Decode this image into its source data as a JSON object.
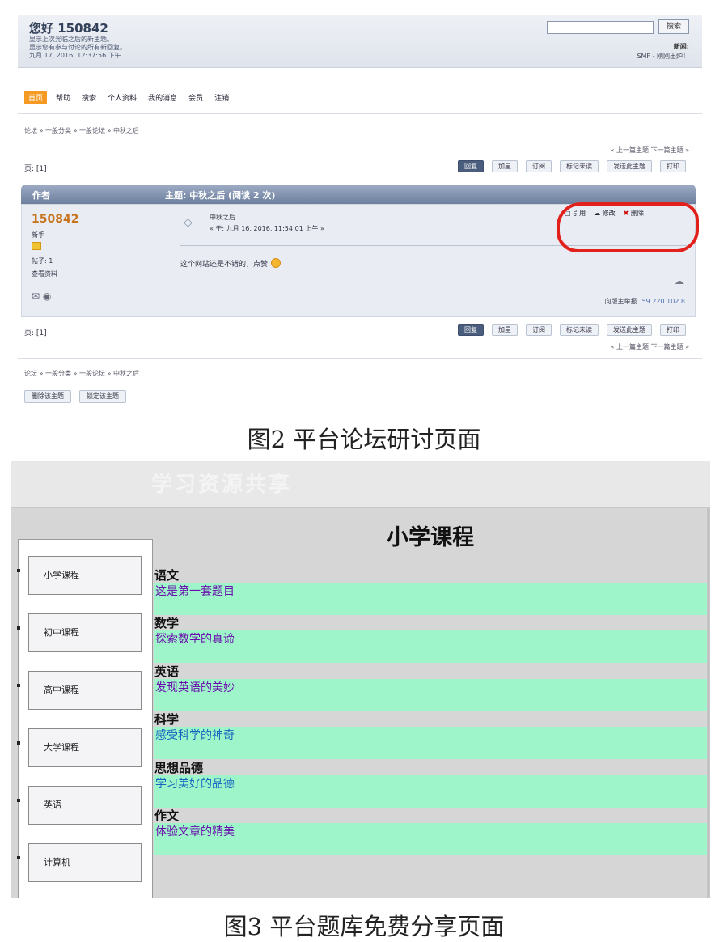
{
  "figure2": {
    "greeting": "您好 150842",
    "top_info": [
      "显示上次光临之后的新主题。",
      "显示您有参与讨论的所有新回复。",
      "九月 17, 2016, 12:37:56 下午"
    ],
    "search": {
      "placeholder": "",
      "button": "搜索"
    },
    "top_right_line1": "新闻:",
    "top_right_line2": "SMF - 刚刚出炉！",
    "nav": [
      "首页",
      "帮助",
      "搜索",
      "个人资料",
      "我的消息",
      "会员",
      "注销"
    ],
    "breadcrumb": "论坛 » 一般分类 » 一般论坛 » 中秋之后",
    "prev_next": "« 上一篇主题 下一篇主题 »",
    "pages": "页: [1]",
    "actions": [
      "回复",
      "加星",
      "订阅",
      "标记未读",
      "发送此主题",
      "打印"
    ],
    "post_header": {
      "author": "作者",
      "topic": "主题: 中秋之后  (阅读 2 次)"
    },
    "post": {
      "poster": "150842",
      "rank": "新手",
      "posts": "帖子: 1",
      "status": "查看资料",
      "title": "中秋之后",
      "date": "« 于: 九月 16, 2016, 11:54:01 上午 »",
      "message": "这个网站还是不错的，点赞",
      "report": "向版主举报",
      "ip": "59.220.102.8"
    },
    "post_actions": [
      "引用",
      "修改",
      "删除"
    ],
    "bottom_buttons": [
      "删除该主题",
      "锁定该主题"
    ],
    "caption": "图2  平台论坛研讨页面"
  },
  "figure3": {
    "site_title": "学习资源共享",
    "page_title": "小学课程",
    "sidebar": [
      "小学课程",
      "初中课程",
      "高中课程",
      "大学课程",
      "英语",
      "计算机"
    ],
    "subjects": [
      {
        "name": "语文",
        "link": "这是第一套题目",
        "color": "#6a0dad"
      },
      {
        "name": "数学",
        "link": "探索数学的真谛",
        "color": "#6a0dad"
      },
      {
        "name": "英语",
        "link": "发现英语的美妙",
        "color": "#6a0dad"
      },
      {
        "name": "科学",
        "link": "感受科学的神奇",
        "color": "#1565c0"
      },
      {
        "name": "思想品德",
        "link": "学习美好的品德",
        "color": "#1565c0"
      },
      {
        "name": "作文",
        "link": "体验文章的精美",
        "color": "#6a0dad"
      }
    ],
    "caption": "图3  平台题库免费分享页面"
  }
}
